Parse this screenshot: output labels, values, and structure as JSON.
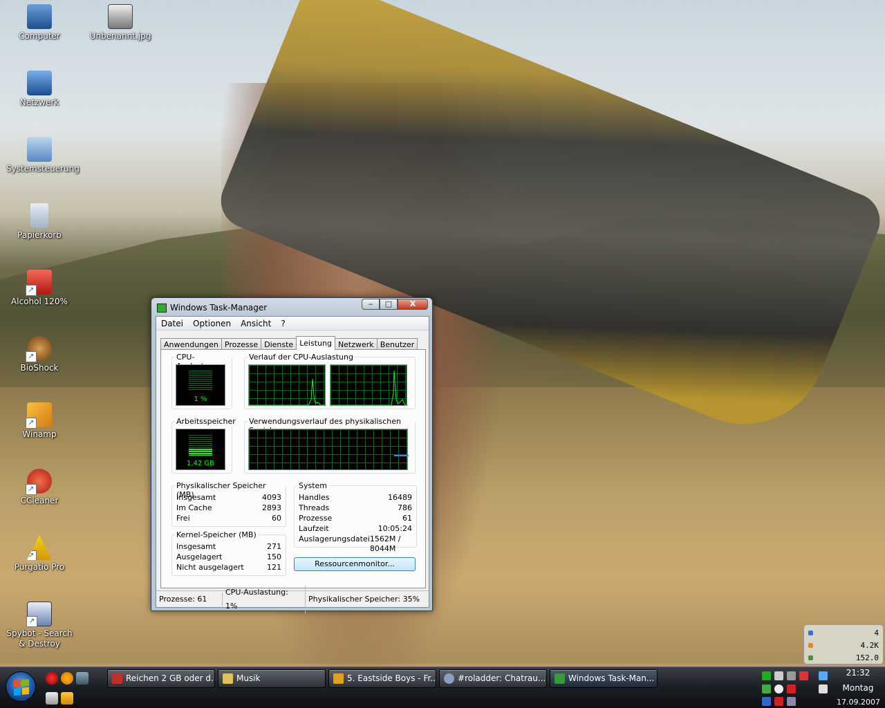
{
  "desktop": {
    "icons": [
      {
        "label": "Computer",
        "icon": "computer-icon"
      },
      {
        "label": "Unbenannt.jpg",
        "icon": "image-file-icon"
      },
      {
        "label": "Netzwerk",
        "icon": "network-icon"
      },
      {
        "label": "Systemsteuerung",
        "icon": "control-panel-icon"
      },
      {
        "label": "Papierkorb",
        "icon": "recycle-bin-icon"
      },
      {
        "label": "Alcohol 120%",
        "icon": "alcohol-icon"
      },
      {
        "label": "BioShock",
        "icon": "bioshock-icon"
      },
      {
        "label": "Winamp",
        "icon": "winamp-icon"
      },
      {
        "label": "CCleaner",
        "icon": "ccleaner-icon"
      },
      {
        "label": "Purgatio Pro",
        "icon": "purgatio-icon"
      },
      {
        "label": "Spybot - Search & Destroy",
        "icon": "spybot-icon"
      }
    ]
  },
  "taskmanager": {
    "title": "Windows Task-Manager",
    "window_buttons": {
      "minimize": "‒",
      "maximize": "□",
      "close": "X"
    },
    "menu": [
      "Datei",
      "Optionen",
      "Ansicht",
      "?"
    ],
    "tabs": [
      "Anwendungen",
      "Prozesse",
      "Dienste",
      "Leistung",
      "Netzwerk",
      "Benutzer"
    ],
    "active_tab": "Leistung",
    "cpu_label": "CPU-Auslastung",
    "cpu_value": "1 %",
    "cpu_history_label": "Verlauf der CPU-Auslastung",
    "mem_label": "Arbeitsspeicher",
    "mem_value": "1,42 GB",
    "mem_history_label": "Verwendungsverlauf des physikalischen Speichers",
    "physical": {
      "label": "Physikalischer Speicher (MB)",
      "rows": [
        {
          "k": "Insgesamt",
          "v": "4093"
        },
        {
          "k": "Im Cache",
          "v": "2893"
        },
        {
          "k": "Frei",
          "v": "60"
        }
      ]
    },
    "kernel": {
      "label": "Kernel-Speicher (MB)",
      "rows": [
        {
          "k": "Insgesamt",
          "v": "271"
        },
        {
          "k": "Ausgelagert",
          "v": "150"
        },
        {
          "k": "Nicht ausgelagert",
          "v": "121"
        }
      ]
    },
    "system": {
      "label": "System",
      "rows": [
        {
          "k": "Handles",
          "v": "16489"
        },
        {
          "k": "Threads",
          "v": "786"
        },
        {
          "k": "Prozesse",
          "v": "61"
        },
        {
          "k": "Laufzeit",
          "v": "10:05:24"
        },
        {
          "k": "Auslagerungsdatei",
          "v": "1562M / 8044M"
        }
      ]
    },
    "resource_button": "Ressourcenmonitor...",
    "status": {
      "processes": "Prozesse: 61",
      "cpu": "CPU-Auslastung: 1%",
      "memory": "Physikalischer Speicher: 35%"
    }
  },
  "gadget": {
    "rows": [
      {
        "value": "4",
        "color": "#3b6fd6"
      },
      {
        "value": "4.2K",
        "color": "#e08a20"
      },
      {
        "value": "152.0",
        "color": "#3a9a3a"
      }
    ]
  },
  "taskbar": {
    "tasks": [
      {
        "label": "Reichen 2 GB oder d...",
        "icon": "opera-icon",
        "color": "#c0302a"
      },
      {
        "label": "Musik",
        "icon": "folder-icon",
        "color": "#e3c15a"
      },
      {
        "label": "5. Eastside Boys - Fr...",
        "icon": "winamp-icon",
        "color": "#e0a020"
      },
      {
        "label": "#roladder: Chatrau...",
        "icon": "chat-icon",
        "color": "#8aa0c0"
      },
      {
        "label": "Windows Task-Man...",
        "icon": "taskmanager-icon",
        "color": "#3a9a3a"
      }
    ],
    "clock_time": "21:32",
    "clock_day": "Montag",
    "clock_date": "17.09.2007"
  }
}
